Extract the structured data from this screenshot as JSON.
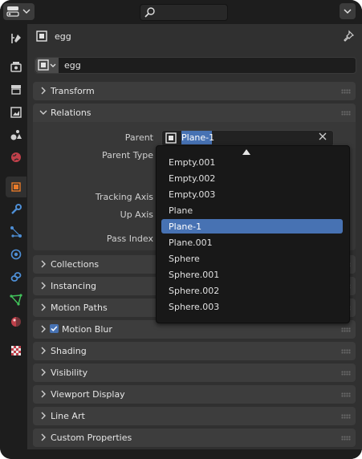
{
  "header": {
    "search_placeholder": "",
    "editor_type_icon": "editor-type-icon",
    "search_icon": "search-icon"
  },
  "tabs": [
    {
      "name": "tool-icon"
    },
    {
      "name": "render-icon"
    },
    {
      "name": "output-icon"
    },
    {
      "name": "view-layer-icon"
    },
    {
      "name": "scene-icon"
    },
    {
      "name": "world-icon"
    },
    {
      "name": "object-icon",
      "active": true
    },
    {
      "name": "modifier-icon"
    },
    {
      "name": "particles-icon"
    },
    {
      "name": "physics-icon"
    },
    {
      "name": "constraints-icon"
    },
    {
      "name": "object-data-icon"
    },
    {
      "name": "material-icon"
    },
    {
      "name": "texture-icon"
    }
  ],
  "object": {
    "title": "egg",
    "name_value": "egg"
  },
  "panels": {
    "transform": "Transform",
    "relations": "Relations",
    "collections": "Collections",
    "instancing": "Instancing",
    "motion_paths": "Motion Paths",
    "motion_blur": "Motion Blur",
    "shading": "Shading",
    "visibility": "Visibility",
    "viewport_display": "Viewport Display",
    "line_art": "Line Art",
    "custom_properties": "Custom Properties"
  },
  "relations": {
    "parent_label": "Parent",
    "parent_value": "Plane-1",
    "parent_type_label": "Parent Type",
    "tracking_axis_label": "Tracking Axis",
    "up_axis_label": "Up Axis",
    "pass_index_label": "Pass Index"
  },
  "dropdown": {
    "items": [
      "Empty.001",
      "Empty.002",
      "Empty.003",
      "Plane",
      "Plane-1",
      "Plane.001",
      "Sphere",
      "Sphere.001",
      "Sphere.002",
      "Sphere.003"
    ],
    "selected": "Plane-1"
  },
  "colors": {
    "accent": "#4772b3",
    "object_orange": "#e87b2a"
  }
}
